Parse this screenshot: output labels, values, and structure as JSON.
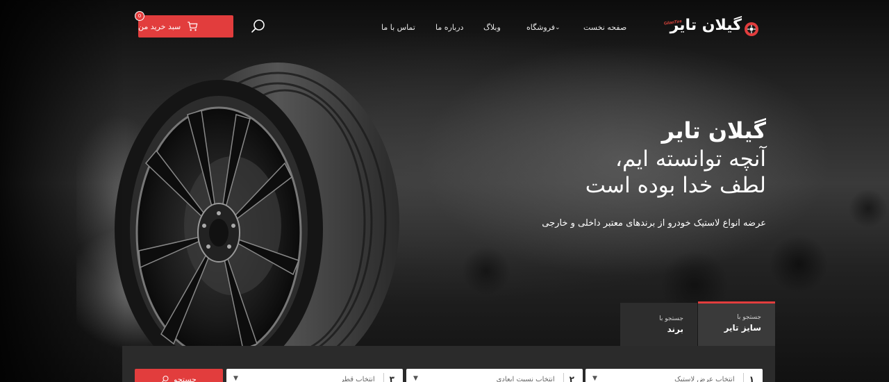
{
  "header": {
    "logo_text": "گیلان تایر",
    "logo_sub": "GilanTire",
    "nav": {
      "home": "صفحه نخست",
      "shop": "فروشگاه",
      "blog": "وبلاگ",
      "about": "درباره ما",
      "contact": "تماس با ما"
    },
    "cart_label": "سبد خرید من",
    "cart_count": "0"
  },
  "hero": {
    "title": "گیلان تایر",
    "subtitle_line1": "آنچه توانسته ایم،",
    "subtitle_line2": "لطف خدا بوده است",
    "description": "عرضه انواع لاستیک خودرو از برندهای معتبر داخلی و خارجی"
  },
  "search": {
    "tabs": [
      {
        "small": "جستجو با",
        "big": "سایز تایر"
      },
      {
        "small": "جستجو با",
        "big": "برند"
      }
    ],
    "selects": [
      {
        "num": "۱",
        "placeholder": "انتخاب عرض لاستیک"
      },
      {
        "num": "۲",
        "placeholder": "انتخاب نسبت ابعادی"
      },
      {
        "num": "۳",
        "placeholder": "انتخاب قطر"
      }
    ],
    "submit_label": "جستجو"
  },
  "colors": {
    "accent": "#e23d3d",
    "panel": "#2b2b2b",
    "tab_active": "#3a3a3a"
  },
  "icons": {
    "search": "search-icon",
    "cart": "cart-icon",
    "chevron": "chevron-down-icon",
    "logo": "wheel-logo-icon"
  }
}
